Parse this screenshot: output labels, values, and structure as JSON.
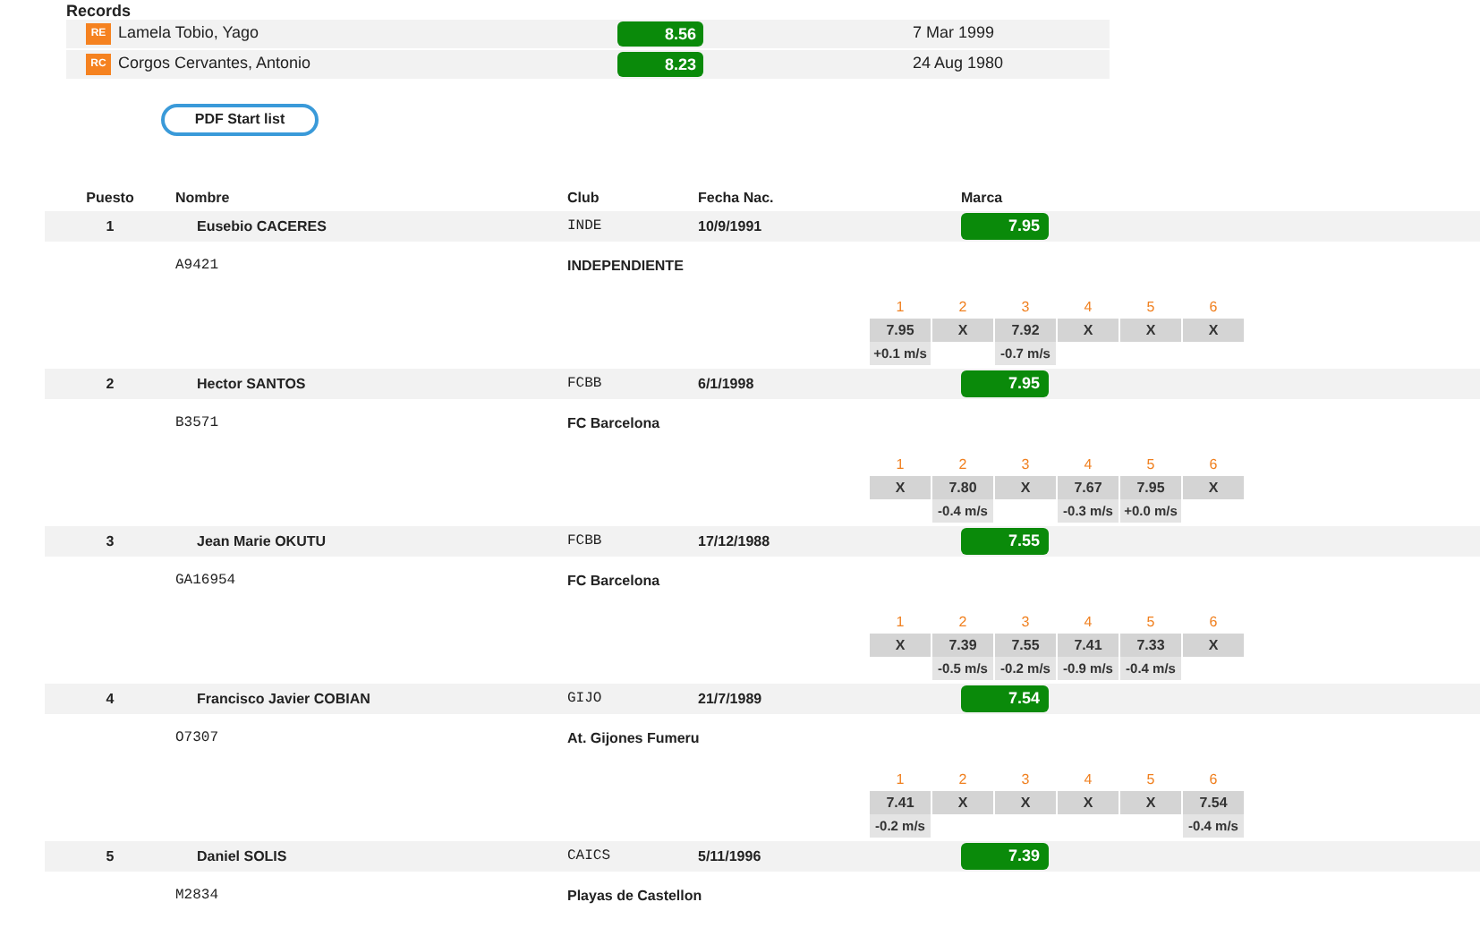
{
  "records": {
    "title": "Records",
    "rows": [
      {
        "code": "RE",
        "name": "Lamela Tobio, Yago",
        "mark": "8.56",
        "date": "7 Mar 1999"
      },
      {
        "code": "RC",
        "name": "Corgos Cervantes, Antonio",
        "mark": "8.23",
        "date": "24 Aug 1980"
      }
    ]
  },
  "pdf_button": "PDF Start list",
  "table": {
    "columns": [
      "Puesto",
      "Nombre",
      "Club",
      "Fecha Nac.",
      "Marca"
    ],
    "rows": [
      {
        "place": "1",
        "name": "Eusebio CACERES",
        "club_code": "INDE",
        "birth": "10/9/1991",
        "mark": "7.95",
        "licence": "A9421",
        "club": "INDEPENDIENTE",
        "attempts": [
          {
            "n": "1",
            "mark": "7.95",
            "wind": "+0.1 m/s"
          },
          {
            "n": "2",
            "mark": "X"
          },
          {
            "n": "3",
            "mark": "7.92",
            "wind": "-0.7 m/s"
          },
          {
            "n": "4",
            "mark": "X"
          },
          {
            "n": "5",
            "mark": "X"
          },
          {
            "n": "6",
            "mark": "X"
          }
        ]
      },
      {
        "place": "2",
        "name": "Hector SANTOS",
        "club_code": "FCBB",
        "birth": "6/1/1998",
        "mark": "7.95",
        "licence": "B3571",
        "club": "FC Barcelona",
        "attempts": [
          {
            "n": "1",
            "mark": "X"
          },
          {
            "n": "2",
            "mark": "7.80",
            "wind": "-0.4 m/s"
          },
          {
            "n": "3",
            "mark": "X"
          },
          {
            "n": "4",
            "mark": "7.67",
            "wind": "-0.3 m/s"
          },
          {
            "n": "5",
            "mark": "7.95",
            "wind": "+0.0 m/s"
          },
          {
            "n": "6",
            "mark": "X"
          }
        ]
      },
      {
        "place": "3",
        "name": "Jean Marie OKUTU",
        "club_code": "FCBB",
        "birth": "17/12/1988",
        "mark": "7.55",
        "licence": "GA16954",
        "club": "FC Barcelona",
        "attempts": [
          {
            "n": "1",
            "mark": "X"
          },
          {
            "n": "2",
            "mark": "7.39",
            "wind": "-0.5 m/s"
          },
          {
            "n": "3",
            "mark": "7.55",
            "wind": "-0.2 m/s"
          },
          {
            "n": "4",
            "mark": "7.41",
            "wind": "-0.9 m/s"
          },
          {
            "n": "5",
            "mark": "7.33",
            "wind": "-0.4 m/s"
          },
          {
            "n": "6",
            "mark": "X"
          }
        ]
      },
      {
        "place": "4",
        "name": "Francisco Javier COBIAN",
        "club_code": "GIJO",
        "birth": "21/7/1989",
        "mark": "7.54",
        "licence": "O7307",
        "club": "At. Gijones Fumeru",
        "attempts": [
          {
            "n": "1",
            "mark": "7.41",
            "wind": "-0.2 m/s"
          },
          {
            "n": "2",
            "mark": "X"
          },
          {
            "n": "3",
            "mark": "X"
          },
          {
            "n": "4",
            "mark": "X"
          },
          {
            "n": "5",
            "mark": "X"
          },
          {
            "n": "6",
            "mark": "7.54",
            "wind": "-0.4 m/s"
          }
        ]
      },
      {
        "place": "5",
        "name": "Daniel SOLIS",
        "club_code": "CAICS",
        "birth": "5/11/1996",
        "mark": "7.39",
        "licence": "M2834",
        "club": "Playas de Castellon"
      }
    ]
  }
}
